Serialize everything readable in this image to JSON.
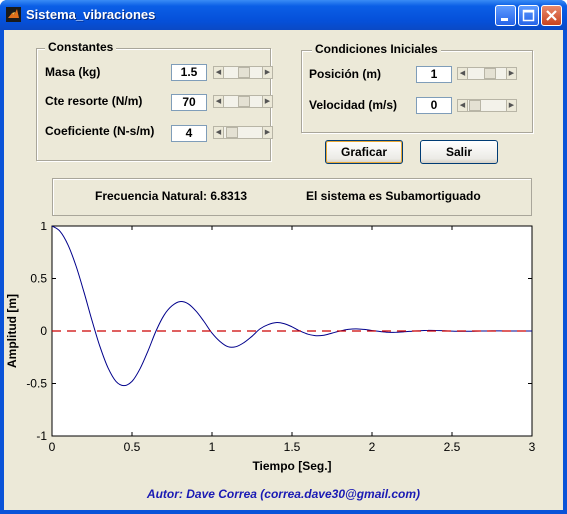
{
  "window": {
    "title": "Sistema_vibraciones"
  },
  "constantes": {
    "title": "Constantes",
    "fields": [
      {
        "label": "Masa (kg)",
        "value": "1.5",
        "slider_fraction": 0.45
      },
      {
        "label": "Cte resorte (N/m)",
        "value": "70",
        "slider_fraction": 0.45
      },
      {
        "label": "Coeficiente (N-s/m)",
        "value": "4",
        "slider_fraction": 0.1
      }
    ]
  },
  "condiciones": {
    "title": "Condiciones Iniciales",
    "fields": [
      {
        "label": "Posición (m)",
        "value": "1",
        "slider_fraction": 0.5
      },
      {
        "label": "Velocidad (m/s)",
        "value": "0",
        "slider_fraction": 0.05
      }
    ]
  },
  "buttons": {
    "graficar": "Graficar",
    "salir": "Salir"
  },
  "info": {
    "frecuencia": "Frecuencia Natural: 6.8313",
    "estado": "El sistema es Subamortiguado"
  },
  "author": "Autor: Dave Correa (correa.dave30@gmail.com)",
  "chart_data": {
    "type": "line",
    "xlabel": "Tiempo [Seg.]",
    "ylabel": "Amplitud [m]",
    "xlim": [
      0,
      3
    ],
    "ylim": [
      -1,
      1
    ],
    "xticks": [
      "0",
      "0.5",
      "1",
      "1.5",
      "2",
      "2.5",
      "3"
    ],
    "yticks": [
      "1",
      "0.5",
      "0",
      "-0.5",
      "-1"
    ],
    "grid": false,
    "series": [
      {
        "color": "#00008b",
        "style": "solid",
        "x": [
          0,
          0.05,
          0.1,
          0.15,
          0.2,
          0.25,
          0.3,
          0.35,
          0.4,
          0.45,
          0.5,
          0.55,
          0.6,
          0.65,
          0.7,
          0.75,
          0.8,
          0.85,
          0.9,
          0.95,
          1.0,
          1.05,
          1.1,
          1.15,
          1.2,
          1.25,
          1.3,
          1.35,
          1.4,
          1.45,
          1.5,
          1.55,
          1.6,
          1.65,
          1.7,
          1.75,
          1.8,
          1.85,
          1.9,
          1.95,
          2.0,
          2.05,
          2.1,
          2.15,
          2.2,
          2.25,
          2.3,
          2.35,
          2.4,
          2.45,
          2.5,
          2.55,
          2.6,
          2.65,
          2.7,
          2.75,
          2.8,
          2.85,
          2.9,
          2.95,
          3.0
        ],
        "y": [
          1.0,
          0.95,
          0.82,
          0.62,
          0.37,
          0.1,
          -0.15,
          -0.35,
          -0.48,
          -0.52,
          -0.48,
          -0.36,
          -0.19,
          0.0,
          0.15,
          0.24,
          0.28,
          0.26,
          0.19,
          0.09,
          -0.02,
          -0.1,
          -0.15,
          -0.15,
          -0.11,
          -0.05,
          0.02,
          0.06,
          0.08,
          0.07,
          0.04,
          0.0,
          -0.03,
          -0.045,
          -0.04,
          -0.02,
          0.0,
          0.015,
          0.02,
          0.015,
          0.005,
          -0.005,
          -0.012,
          -0.012,
          -0.008,
          -0.002,
          0.003,
          0.006,
          0.005,
          0.002,
          -0.001,
          -0.003,
          -0.003,
          -0.001,
          0.0,
          0.001,
          0.001,
          0.0,
          0.0,
          0.0,
          0.0
        ]
      },
      {
        "color": "#cc0000",
        "style": "dashed",
        "x": [
          0,
          3
        ],
        "y": [
          0,
          0
        ]
      }
    ]
  },
  "colors": {
    "titlebar": "#0550d9",
    "client": "#ece9d8",
    "author_text": "#1a1ab4"
  }
}
